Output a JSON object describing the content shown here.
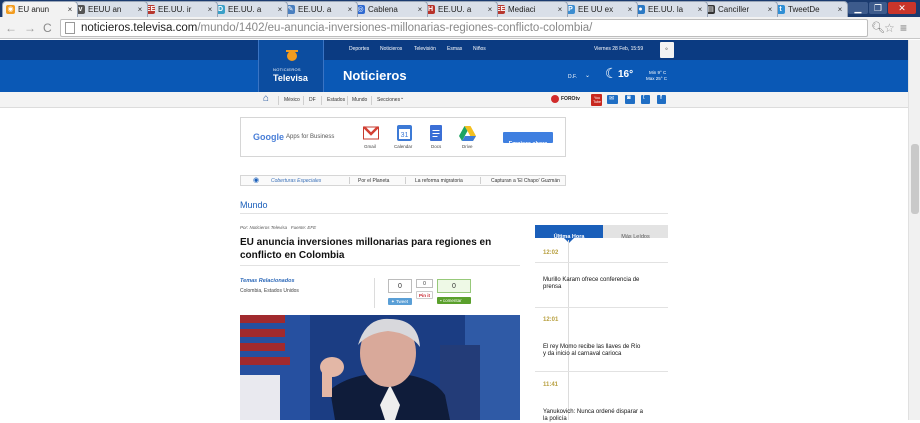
{
  "browser": {
    "tabs": [
      {
        "label": "EU anun",
        "icon": "televisa-eye-icon",
        "color": "#f29c1f",
        "active": true
      },
      {
        "label": "EEUU an",
        "icon": "van-icon",
        "color": "#555555",
        "active": false
      },
      {
        "label": "EE.UU. ir",
        "icon": "ee-icon",
        "color": "#b7372e",
        "active": false
      },
      {
        "label": "EE.UU. a",
        "icon": "dd-icon",
        "color": "#3aa0c8",
        "active": false
      },
      {
        "label": "EE.UU. a",
        "icon": "pen-icon",
        "color": "#4a7fbf",
        "active": false
      },
      {
        "label": "Cablena",
        "icon": "globe-icon",
        "color": "#2f6ad1",
        "active": false
      },
      {
        "label": "EE.UU. a",
        "icon": "h-icon",
        "color": "#b8322a",
        "active": false
      },
      {
        "label": "Mediaci",
        "icon": "ee-icon",
        "color": "#b7372e",
        "active": false
      },
      {
        "label": "EE UU ex",
        "icon": "p-icon",
        "color": "#3c8dd0",
        "active": false
      },
      {
        "label": "EE.UU. la",
        "icon": "circle-icon",
        "color": "#2b79c4",
        "active": false
      },
      {
        "label": "Canciller",
        "icon": "news-icon",
        "color": "#333333",
        "active": false
      },
      {
        "label": "TweetDe",
        "icon": "twitter-icon",
        "color": "#2f8fd5",
        "active": false
      }
    ],
    "close_glyph": "×",
    "url_host": "noticieros.televisa.com",
    "url_path": "/mundo/1402/eu-anuncia-inversiones-millonarias-regiones-conflicto-colombia/"
  },
  "site": {
    "top_nav": [
      "Deportes",
      "Noticieros",
      "Televisión",
      "Esmas",
      "Niños"
    ],
    "date": "Viernes 28 Feb, 15:59",
    "logo_small": "NOTICIEROS",
    "logo_big": "Televisa",
    "section_title": "Noticieros",
    "location": "D.F.",
    "temperature": "16°",
    "temp_min": "Min 9° C",
    "temp_max": "Max 25° C",
    "sub_nav": [
      "México",
      "DF",
      "Estados",
      "Mundo",
      "Secciones"
    ],
    "brand_colors": {
      "dark_blue": "#0b3b82",
      "blue": "#0a58b5",
      "accent": "#1665c1"
    }
  },
  "ad": {
    "google": "Google",
    "apps": "Apps for Business",
    "apps_list": [
      "Gmail",
      "Calendar",
      "Docs",
      "Drive"
    ],
    "cta": "Empieza ahora"
  },
  "coverage": {
    "label": "Coberturas Especiales",
    "items": [
      "Por el Planeta",
      "La reforma migratoria",
      "Capturan a 'El Chapo' Guzmán"
    ]
  },
  "article": {
    "section": "Mundo",
    "byline": "Por: Noticieros Televisa   Fuente: EFE",
    "headline": "EU anuncia inversiones millonarias para regiones en conflicto en Colombia",
    "related_label": "Temas Relacionados",
    "related": "Colombia, Estados Unidos",
    "share": {
      "tweet_count": "0",
      "tweet_label": "Tweet",
      "pin_count": "0",
      "pin_label": "Pin it",
      "comment_count": "0",
      "comment_label": "comentar"
    }
  },
  "sidebar": {
    "tabs": [
      "Última Hora",
      "Más Leídos"
    ],
    "news": [
      {
        "time": "12:02",
        "text": "Murillo Karam ofrece conferencia de prensa"
      },
      {
        "time": "12:01",
        "text": "El rey Momo recibe las llaves de Río y da inicio al carnaval carioca"
      },
      {
        "time": "11:41",
        "text": "Yanukovich: Nunca ordené disparar a la policía"
      }
    ]
  },
  "social_icons": [
    "forotv-icon",
    "youtube-icon",
    "email-icon",
    "rss-icon",
    "twitter-icon",
    "facebook-icon"
  ],
  "social_labels": {
    "forotv": "FOROtv",
    "youtube": "You Tube"
  }
}
